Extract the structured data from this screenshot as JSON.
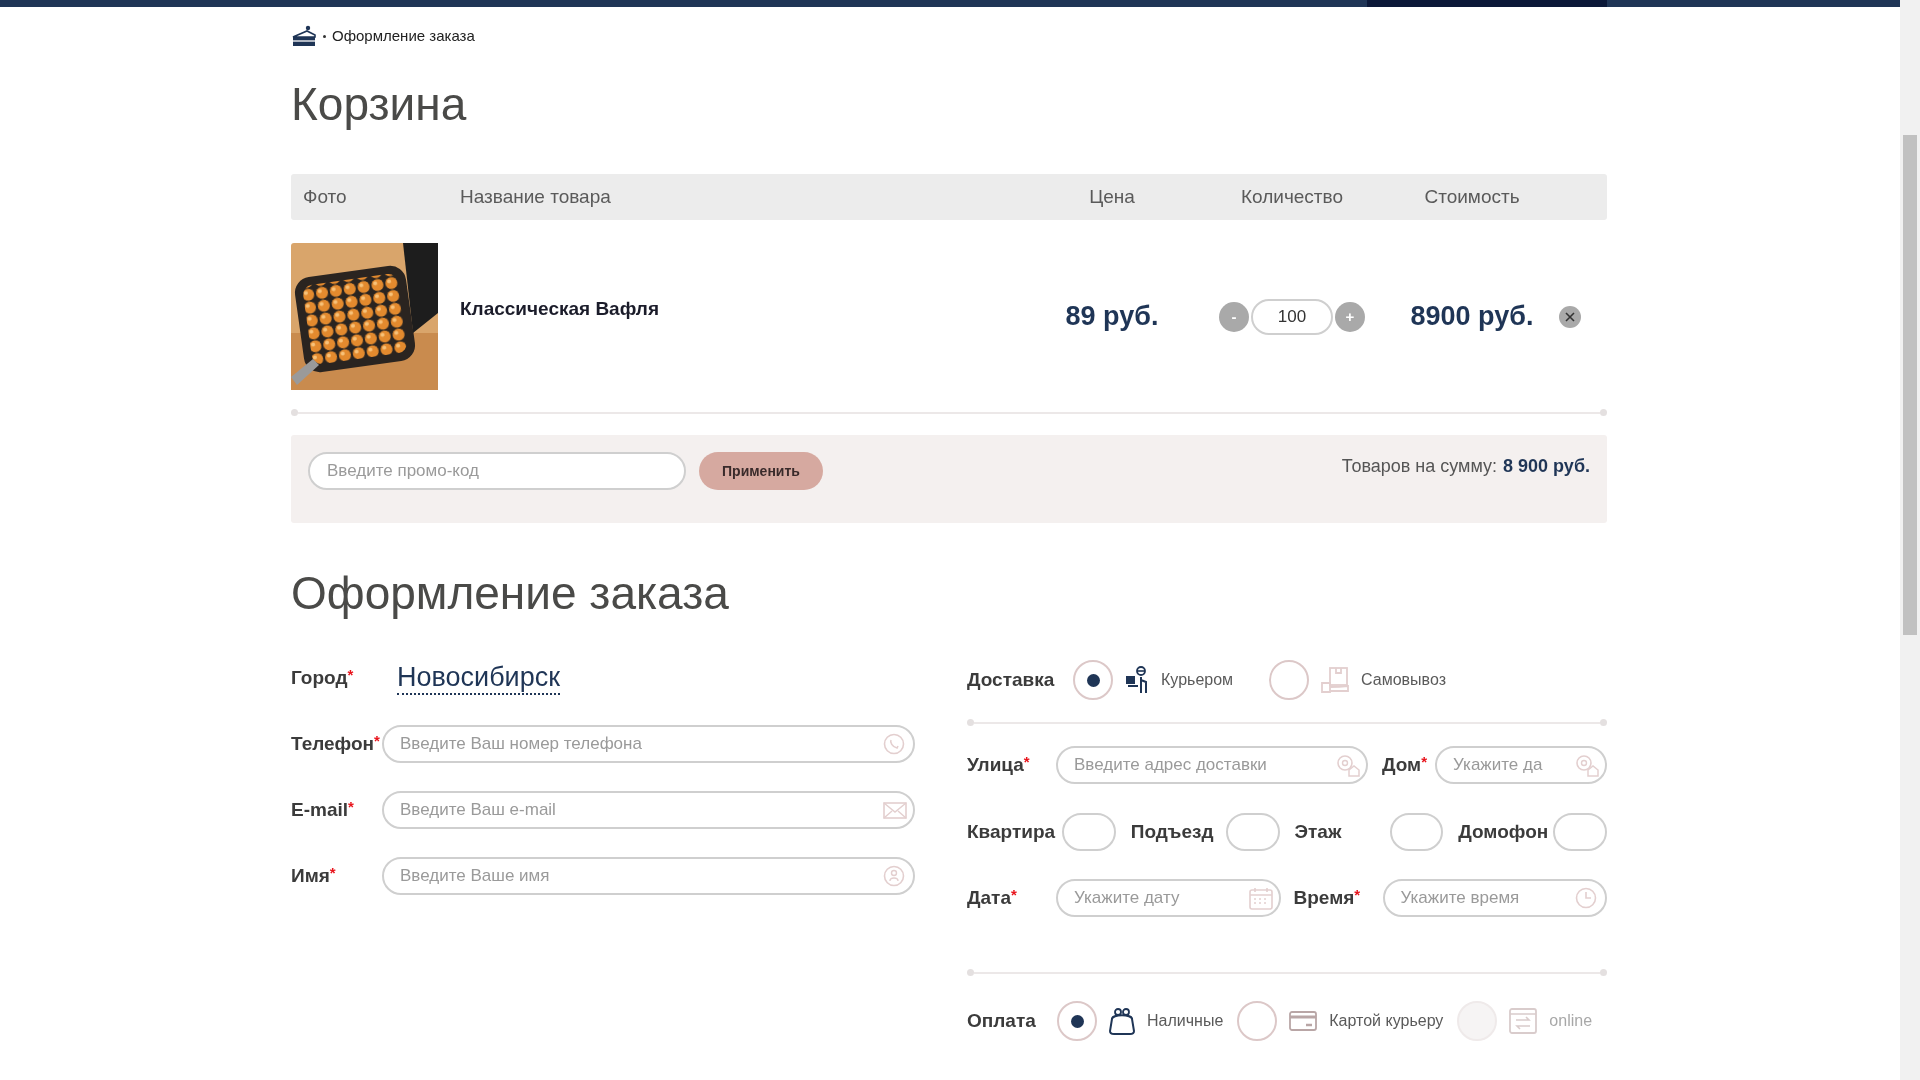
{
  "breadcrumb": {
    "current": "Оформление заказа"
  },
  "cart": {
    "title": "Корзина",
    "columns": [
      "Фото",
      "Название товара",
      "Цена",
      "Количество",
      "Стоимость"
    ],
    "items": [
      {
        "kind": "picture",
        "name": "Классическая Вафля",
        "price": "89 руб.",
        "minus": "-",
        "quantity": "100",
        "plus": "+",
        "total": "8900 руб."
      }
    ],
    "promo": {
      "placeholder": "Введите промо-код",
      "button": "Применить"
    },
    "summary": {
      "label": "Товаров на сумму:",
      "amount": "8 900 руб."
    }
  },
  "checkout": {
    "title": "Оформление заказа",
    "contact_fields": [
      {
        "kind": "city",
        "label": "Город",
        "mark": "*",
        "value": "Новосибирск"
      },
      {
        "kind": "phone",
        "label": "Телефон",
        "mark": "*",
        "placeholder": "Введите Ваш номер телефона"
      },
      {
        "kind": "email",
        "label": "E-mail",
        "mark": "*",
        "placeholder": "Введите Ваш e-mail"
      },
      {
        "kind": "person",
        "label": "Имя",
        "mark": "*",
        "placeholder": "Введите Ваше имя"
      }
    ],
    "delivery": {
      "label": "Доставка",
      "options": [
        {
          "kind": "courier",
          "label": "Курьером",
          "selected": true
        },
        {
          "kind": "pickup",
          "label": "Самовывоз",
          "selected": false
        }
      ]
    },
    "address_rows": [
      [
        {
          "kind": "pin",
          "label": "Улица",
          "mark": "*",
          "placeholder": "Введите адрес доставки"
        },
        {
          "kind": "pin",
          "label": "Дом",
          "mark": "*",
          "placeholder": "Укажите да"
        }
      ],
      [
        {
          "kind": "plain",
          "label": "Квартира"
        },
        {
          "kind": "plain",
          "label": "Подъезд"
        },
        {
          "kind": "plain",
          "label": "Этаж"
        },
        {
          "kind": "plain",
          "label": "Домофон"
        }
      ],
      [
        {
          "kind": "calendar",
          "label": "Дата",
          "mark": "*",
          "placeholder": "Укажите дату"
        },
        {
          "kind": "clock",
          "label": "Время",
          "mark": "*",
          "placeholder": "Укажите время"
        }
      ]
    ],
    "payment": {
      "label": "Оплата",
      "options": [
        {
          "kind": "cash",
          "label": "Наличные",
          "selected": true,
          "disabled": false
        },
        {
          "kind": "card",
          "label": "Картой курьеру",
          "selected": false,
          "disabled": false
        },
        {
          "kind": "online",
          "label": "online",
          "selected": false,
          "disabled": true
        }
      ]
    }
  }
}
